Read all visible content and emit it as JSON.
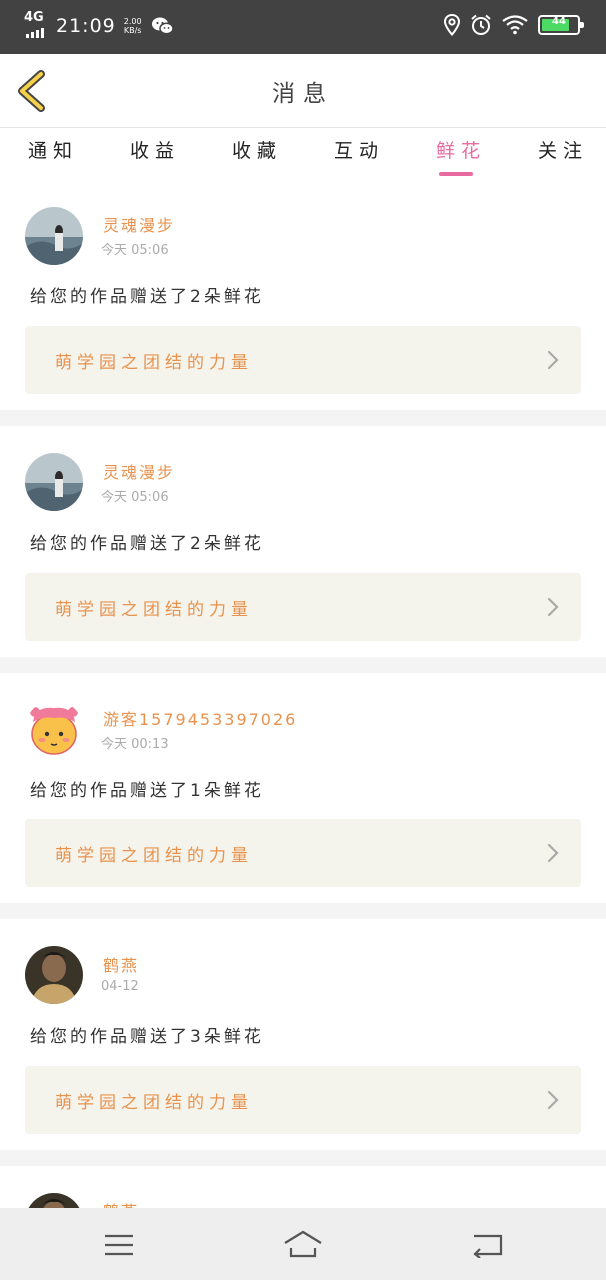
{
  "status_bar": {
    "network": "4G",
    "time": "21:09",
    "speed_value": "2.00",
    "speed_unit": "KB/s",
    "battery": "44",
    "icons": [
      "signal-icon",
      "wechat-icon",
      "location-icon",
      "alarm-icon",
      "wifi-icon",
      "battery-icon"
    ]
  },
  "header": {
    "title": "消息",
    "back_icon": "chevron-left-icon"
  },
  "tabs": {
    "items": [
      "通知",
      "收益",
      "收藏",
      "互动",
      "鲜花",
      "关注"
    ],
    "active": "鲜花"
  },
  "colors": {
    "accent": "#e86aa0",
    "username": "#e8924e",
    "card_bg": "#f4f4ec"
  },
  "messages": [
    {
      "username": "灵魂漫步",
      "time": "今天 05:06",
      "text": "给您的作品赠送了2朵鲜花",
      "work_title": "萌学园之团结的力量"
    },
    {
      "username": "灵魂漫步",
      "time": "今天 05:06",
      "text": "给您的作品赠送了2朵鲜花",
      "work_title": "萌学园之团结的力量"
    },
    {
      "username": "游客1579453397026",
      "time": "今天 00:13",
      "text": "给您的作品赠送了1朵鲜花",
      "work_title": "萌学园之团结的力量"
    },
    {
      "username": "鹤燕",
      "time": "04-12",
      "text": "给您的作品赠送了3朵鲜花",
      "work_title": "萌学园之团结的力量"
    },
    {
      "username": "鹤燕"
    }
  ],
  "nav_bar": {
    "icons": [
      "menu-icon",
      "home-icon",
      "back-icon"
    ]
  }
}
